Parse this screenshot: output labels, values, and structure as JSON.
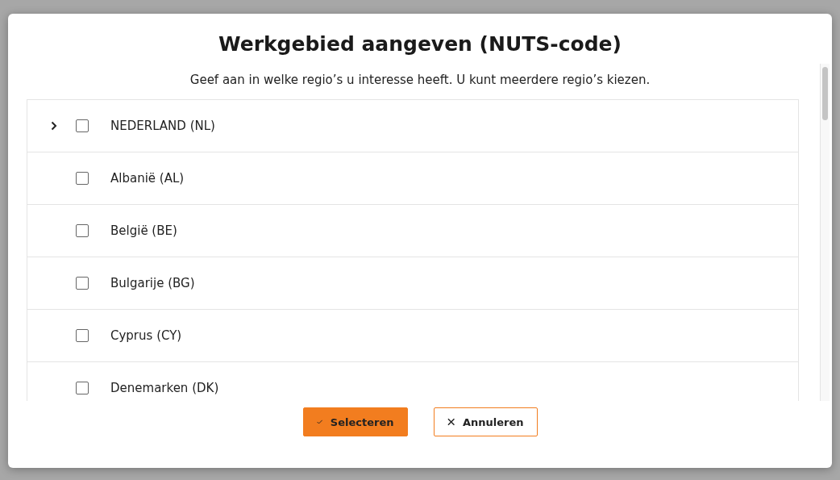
{
  "dialog": {
    "title": "Werkgebied aangeven (NUTS-code)",
    "subtitle": "Geef aan in welke regio’s u interesse heeft. U kunt meerdere regio’s kiezen.",
    "regions": [
      {
        "label": "NEDERLAND (NL)",
        "expandable": true,
        "checked": false
      },
      {
        "label": "Albanië (AL)",
        "expandable": false,
        "checked": false
      },
      {
        "label": "België (BE)",
        "expandable": false,
        "checked": false
      },
      {
        "label": "Bulgarije (BG)",
        "expandable": false,
        "checked": false
      },
      {
        "label": "Cyprus (CY)",
        "expandable": false,
        "checked": false
      },
      {
        "label": "Denemarken (DK)",
        "expandable": false,
        "checked": false
      }
    ],
    "buttons": [
      {
        "label": "Selecteren",
        "kind": "primary"
      },
      {
        "label": "Annuleren",
        "kind": "secondary"
      }
    ]
  }
}
